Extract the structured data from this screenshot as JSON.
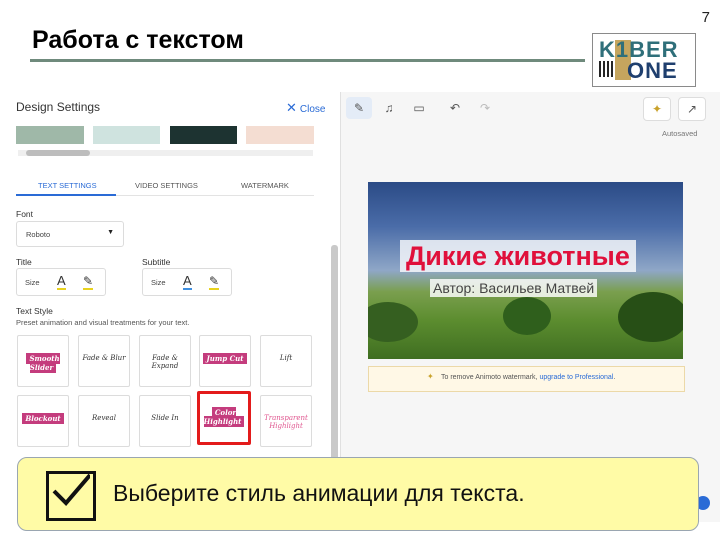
{
  "slide": {
    "title": "Работа с текстом",
    "page_number": "7",
    "logo": {
      "line1": "K1BER",
      "line2": "ONE"
    }
  },
  "panel": {
    "title": "Design Settings",
    "close_label": "Close",
    "tabs": [
      {
        "label": "TEXT SETTINGS",
        "active": true
      },
      {
        "label": "VIDEO SETTINGS",
        "active": false
      },
      {
        "label": "WATERMARK",
        "active": false
      }
    ],
    "font_label": "Font",
    "font_value": "Roboto",
    "title_label": "Title",
    "subtitle_label": "Subtitle",
    "size_label": "Size",
    "text_style_label": "Text Style",
    "text_style_desc": "Preset animation and visual treatments for your text.",
    "styles": [
      {
        "label": "Smooth Slider",
        "pink": true
      },
      {
        "label": "Fade & Blur"
      },
      {
        "label": "Fade & Expand"
      },
      {
        "label": "Jump Cut",
        "pink": true
      },
      {
        "label": "Lift"
      },
      {
        "label": "Blockout",
        "pink": true
      },
      {
        "label": "Reveal"
      },
      {
        "label": "Slide In"
      },
      {
        "label": "Color Highlight",
        "pink": true,
        "highlighted": true
      },
      {
        "label": "Transparent Highlight",
        "pinktext": true
      }
    ]
  },
  "editor": {
    "autosaved": "Autosaved",
    "video_title": "Дикие животные",
    "video_subtitle": "Автор: Васильев Матвей",
    "banner_text": "To remove Animoto watermark,",
    "banner_link": "upgrade to Professional"
  },
  "instruction": {
    "text": "Выберите стиль анимации для текста."
  },
  "colors": {
    "accent": "#2a6bd6",
    "highlight_red": "#e31b1b",
    "instruction_bg": "#fffba6"
  }
}
